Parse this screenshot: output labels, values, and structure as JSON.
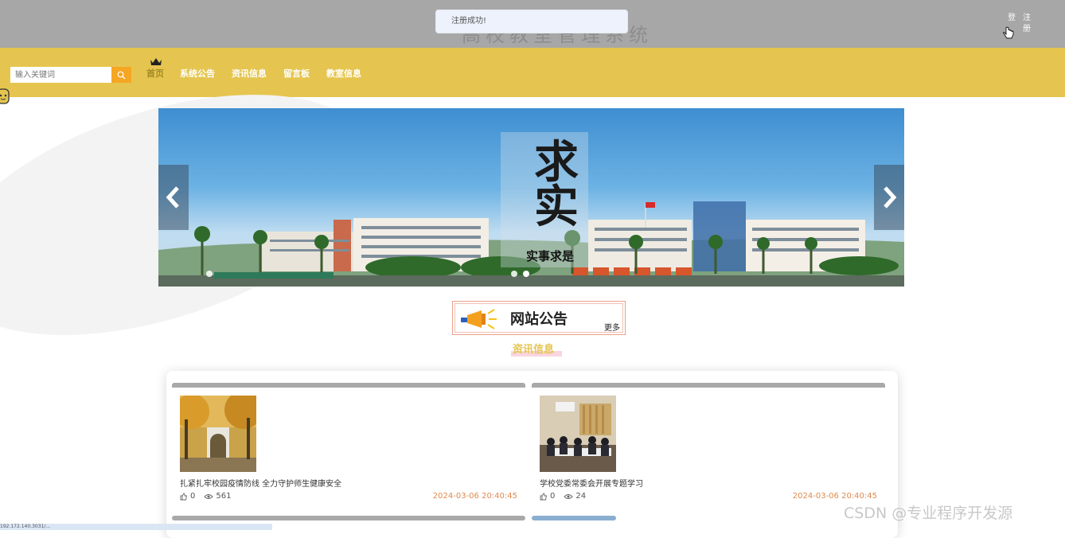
{
  "header": {
    "ghost_title": "高校教室管理系统",
    "toast": "注册成功!",
    "login": "登",
    "register": "注册"
  },
  "search": {
    "placeholder": "输入关键词",
    "icon": "search-icon"
  },
  "nav": {
    "items": [
      "首页",
      "系统公告",
      "资讯信息",
      "留言板",
      "教室信息"
    ]
  },
  "banner": {
    "calligraphy": "求实",
    "motto": "实事求是"
  },
  "notice": {
    "title": "网站公告",
    "more": "更多"
  },
  "news": {
    "heading": "资讯信息",
    "cards": [
      {
        "title": "扎紧扎牢校园疫情防线 全力守护师生健康安全",
        "likes": "0",
        "views": "561",
        "date": "2024-03-06 20:40:45"
      },
      {
        "title": "学校党委常委会开展专题学习",
        "likes": "0",
        "views": "24",
        "date": "2024-03-06 20:40:45"
      }
    ]
  },
  "watermark": "CSDN @专业程序开发源",
  "status_url": "192.172.140.3031/...",
  "colors": {
    "nav": "#e5c54f",
    "topbar": "#a7a7a7",
    "accent": "#f5a623",
    "date": "#e08a4f"
  }
}
